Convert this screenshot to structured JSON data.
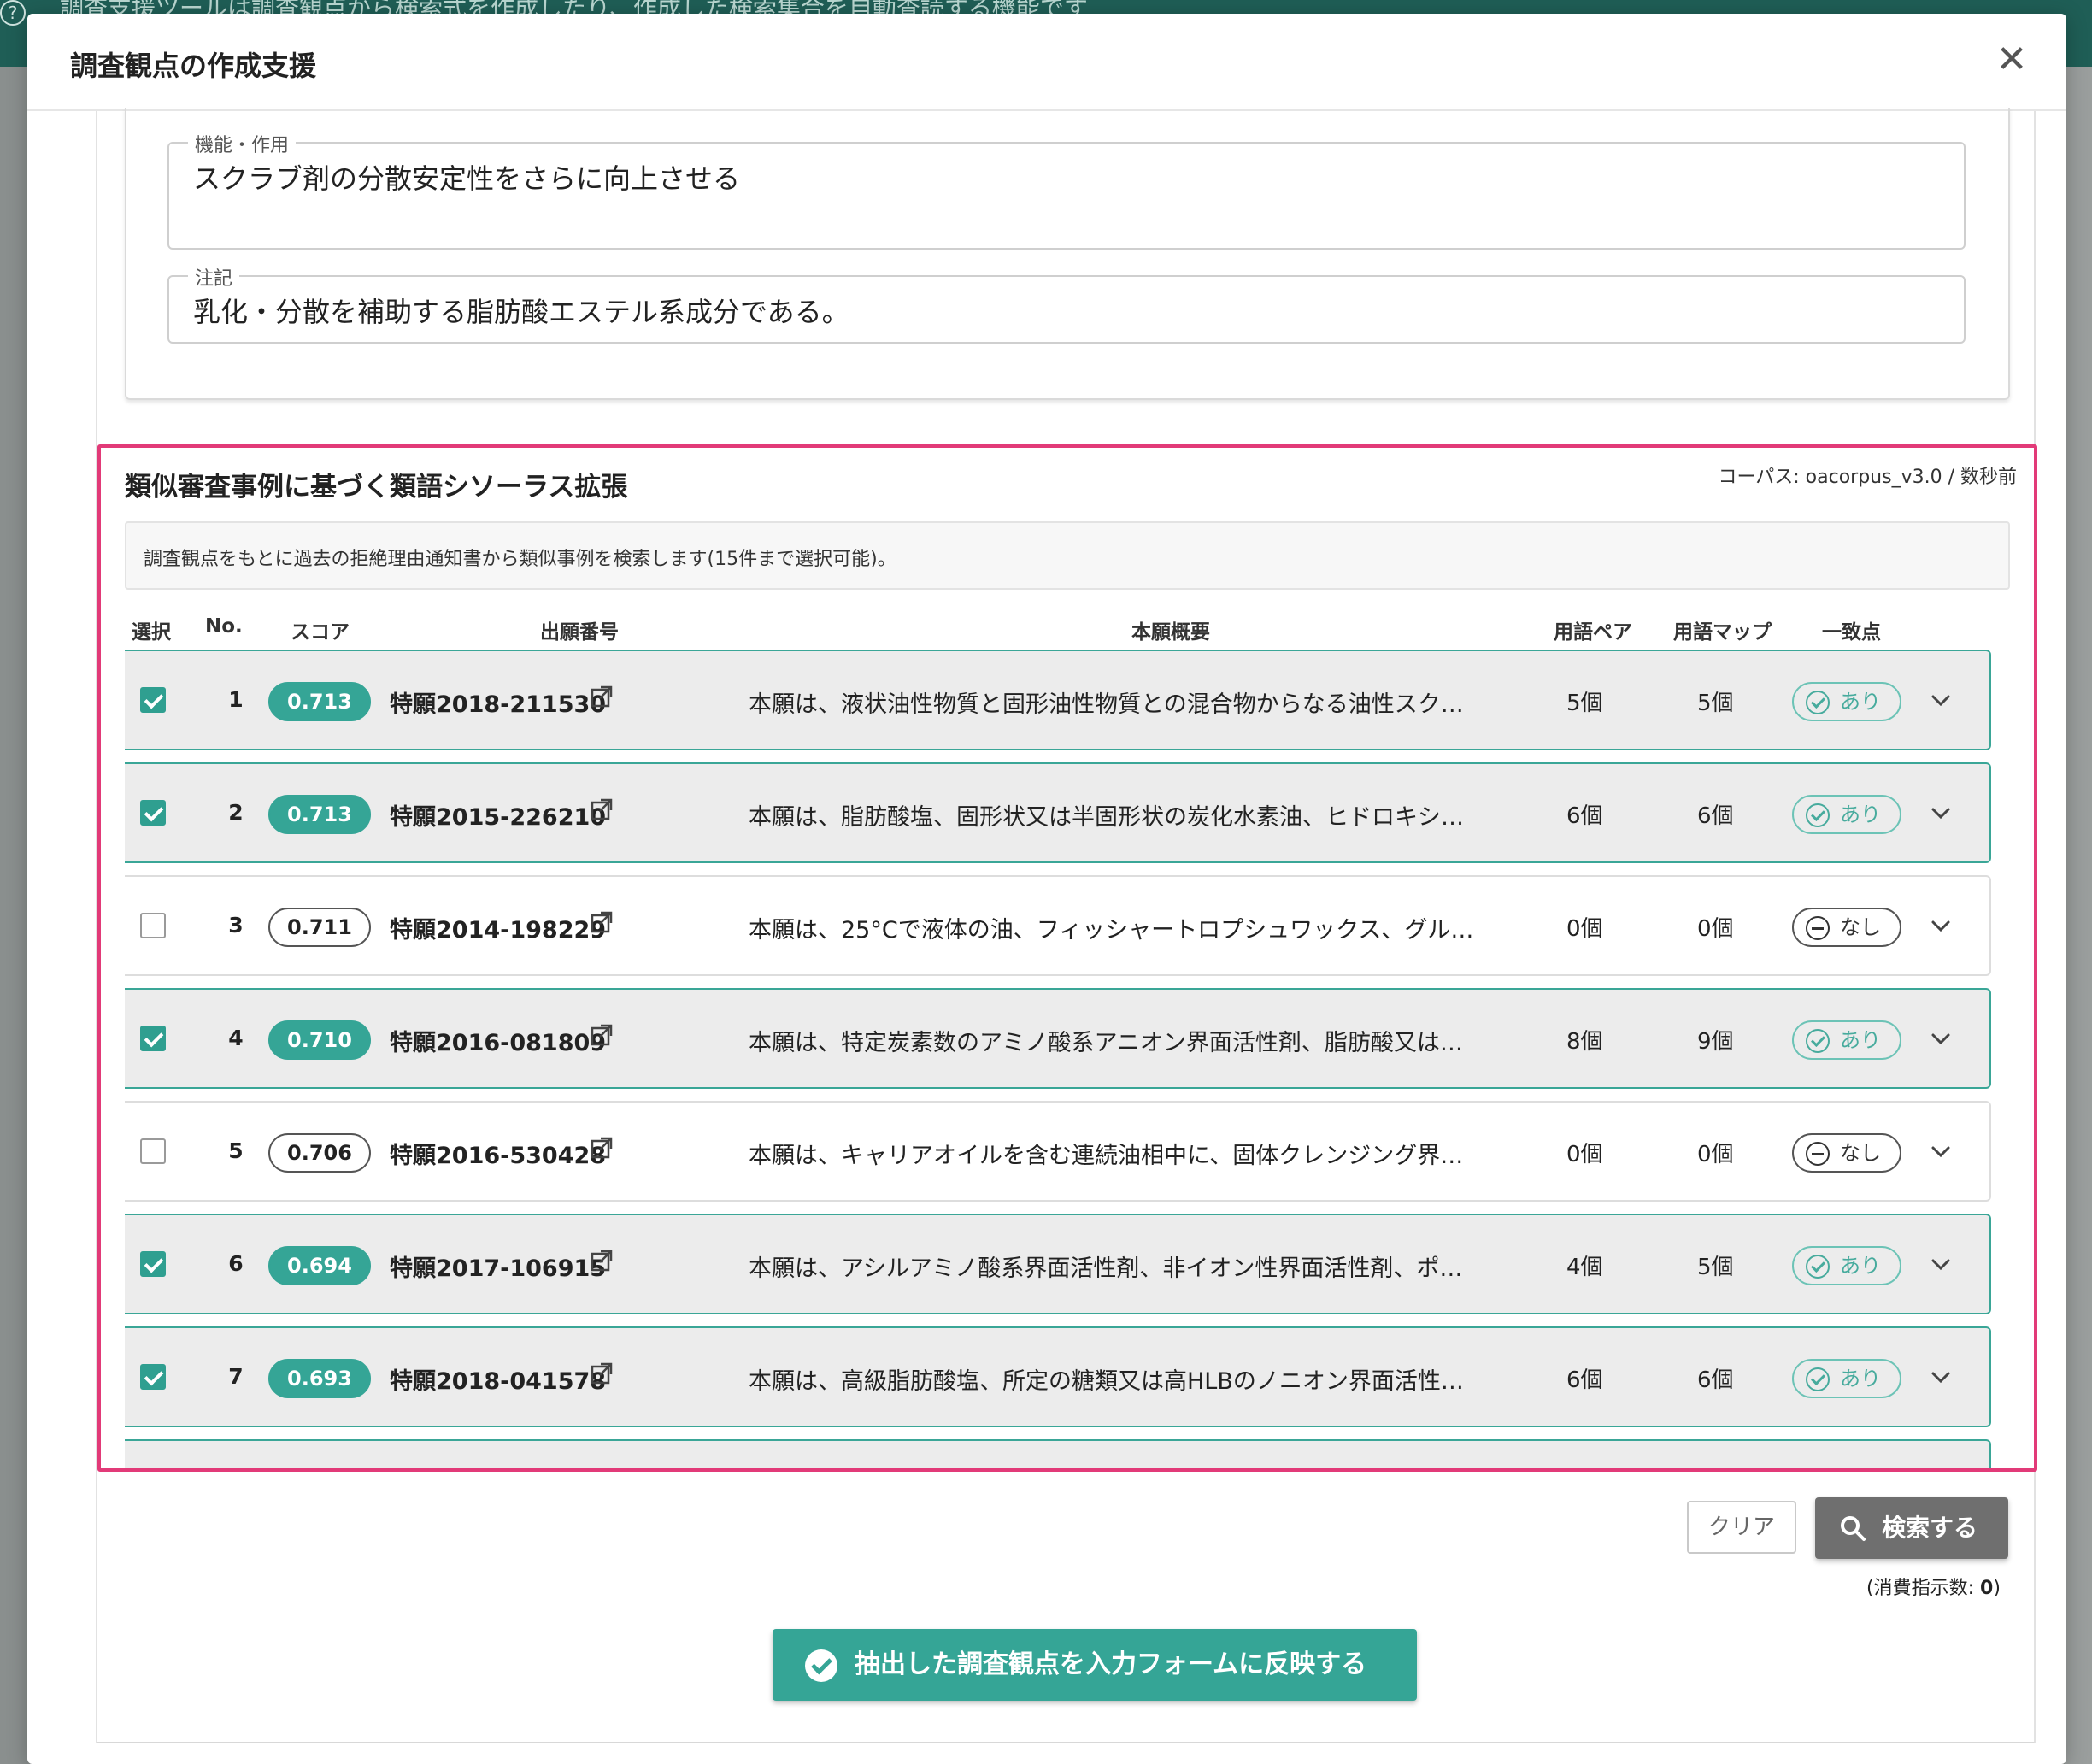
{
  "background": {
    "banner_text": "調査支援ツールは調査観点から検索式を作成したり、作成した検索集合を自動査読する機能です"
  },
  "modal": {
    "title": "調査観点の作成支援",
    "close_icon": "close-icon"
  },
  "fields": {
    "function": {
      "label": "機能・作用",
      "value": "スクラブ剤の分散安定性をさらに向上させる"
    },
    "note": {
      "label": "注記",
      "value": "乳化・分散を補助する脂肪酸エステル系成分である。"
    }
  },
  "section": {
    "title": "類似審査事例に基づく類語シソーラス拡張",
    "corpus": "コーパス: oacorpus_v3.0 / 数秒前",
    "info": "調査観点をもとに過去の拒絶理由通知書から類似事例を検索します(15件まで選択可能)。"
  },
  "table": {
    "headers": {
      "select": "選択",
      "no": "No.",
      "score": "スコア",
      "appno": "出願番号",
      "summary": "本願概要",
      "pairs": "用語ペア",
      "maps": "用語マップ",
      "match": "一致点"
    },
    "rows": [
      {
        "selected": true,
        "no": "1",
        "score": "0.713",
        "appno": "特願2018-211530",
        "summary": "本願は、液状油性物質と固形油性物質との混合物からなる油性スク…",
        "pairs": "5個",
        "maps": "5個",
        "match": "あり",
        "match_yes": true
      },
      {
        "selected": true,
        "no": "2",
        "score": "0.713",
        "appno": "特願2015-226210",
        "summary": "本願は、脂肪酸塩、固形状又は半固形状の炭化水素油、ヒドロキシ…",
        "pairs": "6個",
        "maps": "6個",
        "match": "あり",
        "match_yes": true
      },
      {
        "selected": false,
        "no": "3",
        "score": "0.711",
        "appno": "特願2014-198229",
        "summary": "本願は、25°Cで液体の油、フィッシャートロプシュワックス、グル…",
        "pairs": "0個",
        "maps": "0個",
        "match": "なし",
        "match_yes": false
      },
      {
        "selected": true,
        "no": "4",
        "score": "0.710",
        "appno": "特願2016-081809",
        "summary": "本願は、特定炭素数のアミノ酸系アニオン界面活性剤、脂肪酸又は…",
        "pairs": "8個",
        "maps": "9個",
        "match": "あり",
        "match_yes": true
      },
      {
        "selected": false,
        "no": "5",
        "score": "0.706",
        "appno": "特願2016-530428",
        "summary": "本願は、キャリアオイルを含む連続油相中に、固体クレンジング界…",
        "pairs": "0個",
        "maps": "0個",
        "match": "なし",
        "match_yes": false
      },
      {
        "selected": true,
        "no": "6",
        "score": "0.694",
        "appno": "特願2017-106915",
        "summary": "本願は、アシルアミノ酸系界面活性剤、非イオン性界面活性剤、ポ…",
        "pairs": "4個",
        "maps": "5個",
        "match": "あり",
        "match_yes": true
      },
      {
        "selected": true,
        "no": "7",
        "score": "0.693",
        "appno": "特願2018-041578",
        "summary": "本願は、高級脂肪酸塩、所定の糖類又は高HLBのノニオン界面活性…",
        "pairs": "6個",
        "maps": "6個",
        "match": "あり",
        "match_yes": true
      }
    ]
  },
  "actions": {
    "clear": "クリア",
    "search": "検索する",
    "consume_label": "(消費指示数: ",
    "consume_value": "0",
    "consume_end": ")",
    "apply": "抽出した調査観点を入力フォームに反映する"
  },
  "colors": {
    "accent": "#35a596",
    "highlight_border": "#e23a78"
  }
}
